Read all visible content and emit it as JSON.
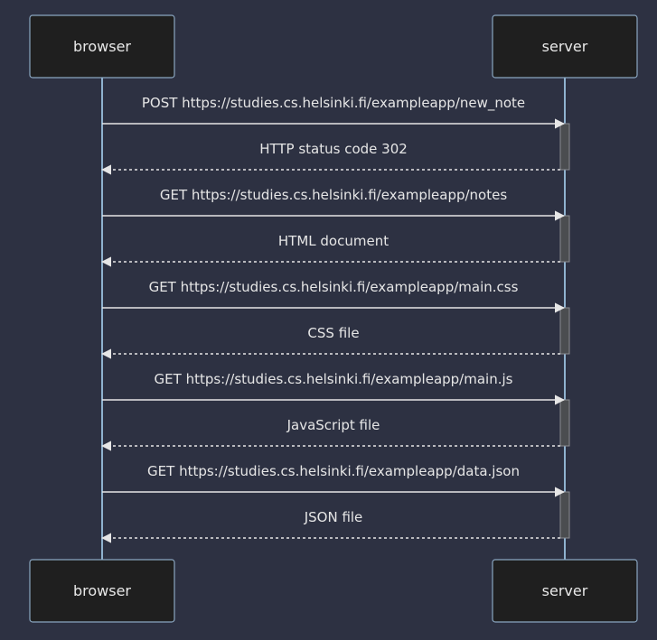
{
  "participants": {
    "browser": "browser",
    "server": "server"
  },
  "colors": {
    "background": "#2d3142",
    "actor_fill": "#1f1f1f",
    "lifeline": "#8fb2cf",
    "activation": "#4b4d50",
    "text": "#e6e6e6"
  },
  "messages": [
    {
      "from": "browser",
      "to": "server",
      "style": "solid",
      "label": "POST https://studies.cs.helsinki.fi/exampleapp/new_note"
    },
    {
      "from": "server",
      "to": "browser",
      "style": "dashed",
      "label": "HTTP status code 302"
    },
    {
      "from": "browser",
      "to": "server",
      "style": "solid",
      "label": "GET https://studies.cs.helsinki.fi/exampleapp/notes"
    },
    {
      "from": "server",
      "to": "browser",
      "style": "dashed",
      "label": "HTML document"
    },
    {
      "from": "browser",
      "to": "server",
      "style": "solid",
      "label": "GET https://studies.cs.helsinki.fi/exampleapp/main.css"
    },
    {
      "from": "server",
      "to": "browser",
      "style": "dashed",
      "label": "CSS file"
    },
    {
      "from": "browser",
      "to": "server",
      "style": "solid",
      "label": "GET https://studies.cs.helsinki.fi/exampleapp/main.js"
    },
    {
      "from": "server",
      "to": "browser",
      "style": "dashed",
      "label": "JavaScript file"
    },
    {
      "from": "browser",
      "to": "server",
      "style": "solid",
      "label": "GET https://studies.cs.helsinki.fi/exampleapp/data.json"
    },
    {
      "from": "server",
      "to": "browser",
      "style": "dashed",
      "label": "JSON file"
    }
  ]
}
